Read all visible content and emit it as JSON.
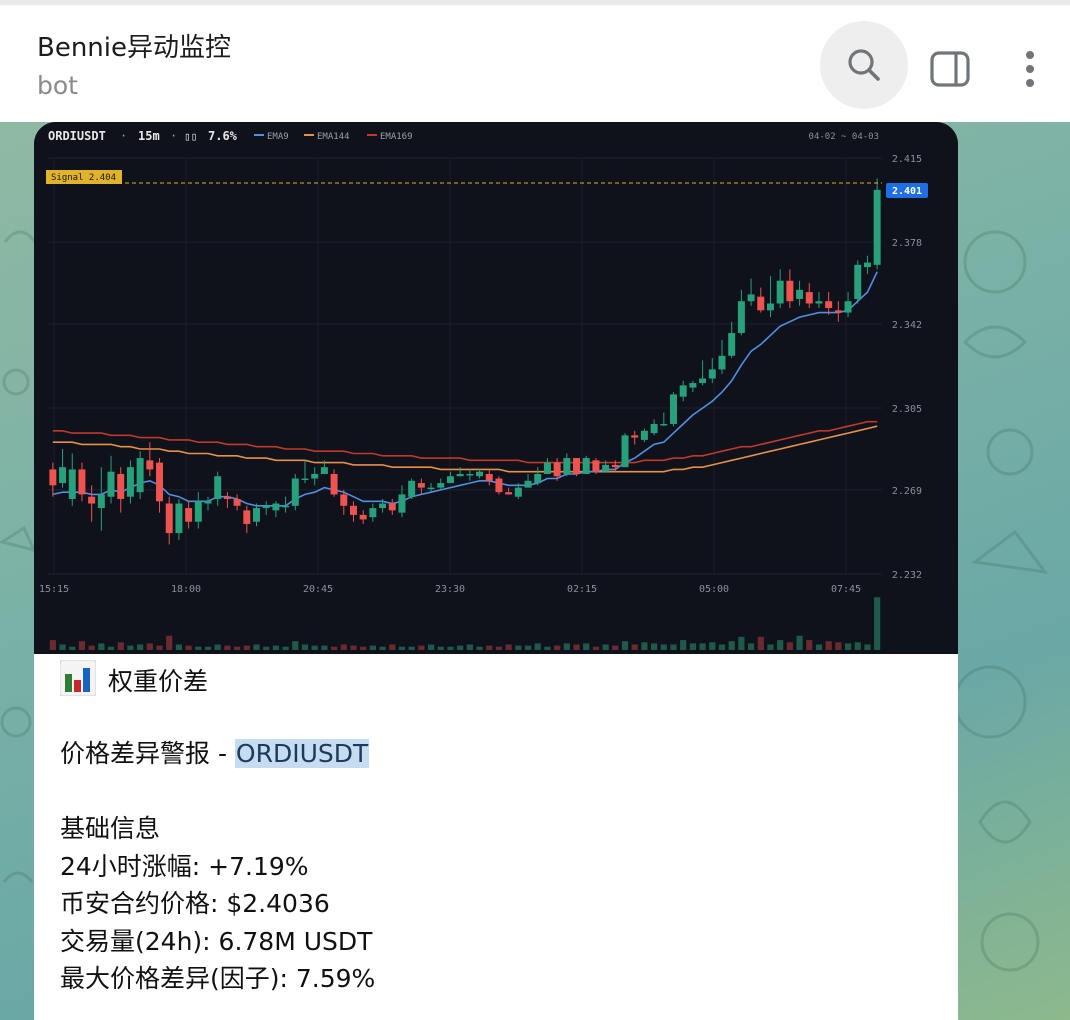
{
  "header": {
    "title": "Bennie异动监控",
    "subtitle": "bot",
    "icons": [
      "search-icon",
      "side-panel-icon",
      "more-vertical-icon"
    ]
  },
  "colors": {
    "bull": "#26a17b",
    "bear": "#ef5350",
    "ema9": "#4f8fe6",
    "ema144": "#e8904a",
    "ema169": "#c0392b",
    "signal": "#e0b32a",
    "chart_bg": "#0f121a",
    "highlight": "#c6dcf0"
  },
  "chart_data": {
    "type": "candlestick",
    "header": {
      "symbol": "ORDIUSDT",
      "sep1": "·",
      "interval": "15m",
      "sep2": "·",
      "tag": "▯▯",
      "change": "7.6%",
      "date_range": "04-02 ~ 04-03"
    },
    "legend": [
      {
        "name": "EMA9",
        "color": "#4f8fe6"
      },
      {
        "name": "EMA144",
        "color": "#e8904a"
      },
      {
        "name": "EMA169",
        "color": "#c0392b"
      }
    ],
    "y_ticks": [
      "2.415",
      "2.378",
      "2.342",
      "2.305",
      "2.269",
      "2.232"
    ],
    "ylim": [
      2.232,
      2.415
    ],
    "x_ticks": [
      "15:15",
      "18:00",
      "20:45",
      "23:30",
      "02:15",
      "05:00",
      "07:45"
    ],
    "signal": {
      "label": "Signal 2.404",
      "value": 2.404
    },
    "last_price": {
      "label": "2.401",
      "value": 2.401
    },
    "candles": [
      [
        2.278,
        2.271,
        2.281,
        2.266
      ],
      [
        2.272,
        2.279,
        2.287,
        2.27
      ],
      [
        2.265,
        2.278,
        2.285,
        2.262
      ],
      [
        2.278,
        2.267,
        2.281,
        2.264
      ],
      [
        2.266,
        2.263,
        2.271,
        2.255
      ],
      [
        2.261,
        2.267,
        2.279,
        2.251
      ],
      [
        2.266,
        2.277,
        2.284,
        2.263
      ],
      [
        2.276,
        2.265,
        2.279,
        2.259
      ],
      [
        2.266,
        2.279,
        2.282,
        2.263
      ],
      [
        2.268,
        2.283,
        2.286,
        2.265
      ],
      [
        2.282,
        2.278,
        2.29,
        2.275
      ],
      [
        2.281,
        2.264,
        2.283,
        2.259
      ],
      [
        2.263,
        2.25,
        2.266,
        2.245
      ],
      [
        2.25,
        2.263,
        2.265,
        2.247
      ],
      [
        2.261,
        2.255,
        2.264,
        2.252
      ],
      [
        2.255,
        2.264,
        2.268,
        2.252
      ],
      [
        2.263,
        2.264,
        2.266,
        2.26
      ],
      [
        2.265,
        2.275,
        2.277,
        2.262
      ],
      [
        2.266,
        2.265,
        2.268,
        2.261
      ],
      [
        2.265,
        2.262,
        2.267,
        2.26
      ],
      [
        2.26,
        2.254,
        2.262,
        2.25
      ],
      [
        2.255,
        2.261,
        2.263,
        2.253
      ],
      [
        2.261,
        2.262,
        2.264,
        2.258
      ],
      [
        2.26,
        2.263,
        2.264,
        2.257
      ],
      [
        2.262,
        2.262,
        2.266,
        2.259
      ],
      [
        2.262,
        2.274,
        2.276,
        2.26
      ],
      [
        2.274,
        2.274,
        2.282,
        2.272
      ],
      [
        2.274,
        2.276,
        2.279,
        2.271
      ],
      [
        2.276,
        2.279,
        2.282,
        2.276
      ],
      [
        2.276,
        2.267,
        2.278,
        2.266
      ],
      [
        2.267,
        2.262,
        2.269,
        2.258
      ],
      [
        2.262,
        2.258,
        2.264,
        2.255
      ],
      [
        2.258,
        2.256,
        2.26,
        2.254
      ],
      [
        2.257,
        2.261,
        2.263,
        2.255
      ],
      [
        2.261,
        2.263,
        2.265,
        2.259
      ],
      [
        2.263,
        2.26,
        2.265,
        2.258
      ],
      [
        2.259,
        2.267,
        2.271,
        2.257
      ],
      [
        2.266,
        2.273,
        2.274,
        2.265
      ],
      [
        2.272,
        2.27,
        2.274,
        2.267
      ],
      [
        2.27,
        2.27,
        2.272,
        2.268
      ],
      [
        2.27,
        2.272,
        2.274,
        2.269
      ],
      [
        2.272,
        2.275,
        2.277,
        2.272
      ],
      [
        2.275,
        2.276,
        2.279,
        2.275
      ],
      [
        2.276,
        2.276,
        2.278,
        2.273
      ],
      [
        2.275,
        2.277,
        2.278,
        2.274
      ],
      [
        2.276,
        2.273,
        2.278,
        2.271
      ],
      [
        2.274,
        2.268,
        2.275,
        2.267
      ],
      [
        2.268,
        2.267,
        2.27,
        2.267
      ],
      [
        2.266,
        2.27,
        2.272,
        2.265
      ],
      [
        2.27,
        2.273,
        2.276,
        2.27
      ],
      [
        2.272,
        2.276,
        2.279,
        2.271
      ],
      [
        2.276,
        2.281,
        2.283,
        2.276
      ],
      [
        2.281,
        2.275,
        2.283,
        2.273
      ],
      [
        2.276,
        2.283,
        2.285,
        2.275
      ],
      [
        2.283,
        2.276,
        2.283,
        2.275
      ],
      [
        2.276,
        2.283,
        2.284,
        2.276
      ],
      [
        2.282,
        2.277,
        2.283,
        2.276
      ],
      [
        2.277,
        2.28,
        2.282,
        2.277
      ],
      [
        2.28,
        2.279,
        2.282,
        2.277
      ],
      [
        2.279,
        2.293,
        2.294,
        2.28
      ],
      [
        2.293,
        2.292,
        2.295,
        2.289
      ],
      [
        2.291,
        2.295,
        2.296,
        2.29
      ],
      [
        2.294,
        2.298,
        2.3,
        2.293
      ],
      [
        2.298,
        2.298,
        2.303,
        2.297
      ],
      [
        2.298,
        2.311,
        2.312,
        2.297
      ],
      [
        2.31,
        2.315,
        2.317,
        2.308
      ],
      [
        2.314,
        2.316,
        2.317,
        2.312
      ],
      [
        2.316,
        2.318,
        2.326,
        2.315
      ],
      [
        2.318,
        2.322,
        2.327,
        2.316
      ],
      [
        2.322,
        2.328,
        2.335,
        2.32
      ],
      [
        2.328,
        2.338,
        2.343,
        2.327
      ],
      [
        2.338,
        2.352,
        2.357,
        2.337
      ],
      [
        2.352,
        2.355,
        2.362,
        2.35
      ],
      [
        2.354,
        2.348,
        2.358,
        2.347
      ],
      [
        2.348,
        2.351,
        2.363,
        2.345
      ],
      [
        2.351,
        2.361,
        2.366,
        2.349
      ],
      [
        2.361,
        2.352,
        2.366,
        2.349
      ],
      [
        2.353,
        2.357,
        2.361,
        2.35
      ],
      [
        2.356,
        2.351,
        2.36,
        2.349
      ],
      [
        2.351,
        2.352,
        2.356,
        2.349
      ],
      [
        2.352,
        2.349,
        2.356,
        2.346
      ],
      [
        2.348,
        2.347,
        2.352,
        2.343
      ],
      [
        2.347,
        2.352,
        2.356,
        2.345
      ],
      [
        2.353,
        2.368,
        2.37,
        2.351
      ],
      [
        2.367,
        2.369,
        2.372,
        2.364
      ],
      [
        2.368,
        2.401,
        2.406,
        2.366
      ]
    ],
    "volumes": [
      0.09,
      0.05,
      0.03,
      0.08,
      0.04,
      0.06,
      0.03,
      0.07,
      0.04,
      0.05,
      0.06,
      0.04,
      0.13,
      0.05,
      0.04,
      0.03,
      0.03,
      0.05,
      0.04,
      0.03,
      0.04,
      0.05,
      0.03,
      0.04,
      0.03,
      0.08,
      0.05,
      0.04,
      0.04,
      0.03,
      0.05,
      0.04,
      0.03,
      0.04,
      0.03,
      0.05,
      0.03,
      0.03,
      0.04,
      0.05,
      0.03,
      0.03,
      0.04,
      0.05,
      0.03,
      0.04,
      0.03,
      0.05,
      0.04,
      0.04,
      0.06,
      0.03,
      0.04,
      0.06,
      0.05,
      0.06,
      0.03,
      0.05,
      0.04,
      0.08,
      0.05,
      0.07,
      0.06,
      0.05,
      0.05,
      0.09,
      0.06,
      0.06,
      0.07,
      0.05,
      0.08,
      0.12,
      0.06,
      0.12,
      0.05,
      0.09,
      0.07,
      0.13,
      0.09,
      0.05,
      0.08,
      0.07,
      0.06,
      0.07,
      0.05,
      0.48
    ],
    "ema9": [
      2.267,
      2.268,
      2.268,
      2.268,
      2.267,
      2.267,
      2.269,
      2.268,
      2.27,
      2.272,
      2.273,
      2.271,
      2.267,
      2.266,
      2.264,
      2.264,
      2.264,
      2.266,
      2.266,
      2.265,
      2.263,
      2.262,
      2.262,
      2.262,
      2.262,
      2.265,
      2.267,
      2.268,
      2.27,
      2.269,
      2.268,
      2.266,
      2.264,
      2.264,
      2.264,
      2.263,
      2.264,
      2.266,
      2.267,
      2.268,
      2.269,
      2.27,
      2.271,
      2.272,
      2.273,
      2.273,
      2.272,
      2.271,
      2.271,
      2.271,
      2.272,
      2.274,
      2.274,
      2.276,
      2.276,
      2.277,
      2.277,
      2.278,
      2.278,
      2.281,
      2.283,
      2.286,
      2.289,
      2.29,
      2.294,
      2.298,
      2.302,
      2.305,
      2.308,
      2.312,
      2.317,
      2.324,
      2.33,
      2.333,
      2.337,
      2.341,
      2.343,
      2.345,
      2.346,
      2.347,
      2.347,
      2.347,
      2.348,
      2.352,
      2.356,
      2.365
    ],
    "ema144": [
      2.29,
      2.29,
      2.29,
      2.289,
      2.289,
      2.289,
      2.289,
      2.288,
      2.288,
      2.287,
      2.287,
      2.287,
      2.286,
      2.286,
      2.285,
      2.285,
      2.285,
      2.284,
      2.284,
      2.284,
      2.283,
      2.283,
      2.283,
      2.282,
      2.282,
      2.282,
      2.282,
      2.281,
      2.281,
      2.281,
      2.281,
      2.28,
      2.28,
      2.28,
      2.28,
      2.279,
      2.279,
      2.279,
      2.279,
      2.279,
      2.278,
      2.278,
      2.278,
      2.278,
      2.278,
      2.278,
      2.278,
      2.277,
      2.277,
      2.277,
      2.277,
      2.277,
      2.277,
      2.277,
      2.277,
      2.277,
      2.277,
      2.277,
      2.277,
      2.277,
      2.277,
      2.277,
      2.277,
      2.277,
      2.278,
      2.278,
      2.279,
      2.279,
      2.28,
      2.281,
      2.282,
      2.283,
      2.284,
      2.285,
      2.286,
      2.287,
      2.288,
      2.289,
      2.29,
      2.291,
      2.292,
      2.293,
      2.294,
      2.295,
      2.296,
      2.297
    ],
    "ema169": [
      2.295,
      2.295,
      2.294,
      2.294,
      2.294,
      2.294,
      2.293,
      2.293,
      2.293,
      2.292,
      2.292,
      2.292,
      2.291,
      2.291,
      2.291,
      2.29,
      2.29,
      2.29,
      2.289,
      2.289,
      2.289,
      2.288,
      2.288,
      2.288,
      2.287,
      2.287,
      2.287,
      2.286,
      2.286,
      2.286,
      2.286,
      2.285,
      2.285,
      2.285,
      2.284,
      2.284,
      2.284,
      2.284,
      2.283,
      2.283,
      2.283,
      2.283,
      2.283,
      2.282,
      2.282,
      2.282,
      2.282,
      2.282,
      2.282,
      2.281,
      2.281,
      2.281,
      2.281,
      2.281,
      2.281,
      2.281,
      2.281,
      2.281,
      2.281,
      2.281,
      2.281,
      2.282,
      2.282,
      2.282,
      2.283,
      2.283,
      2.284,
      2.284,
      2.285,
      2.286,
      2.287,
      2.288,
      2.288,
      2.289,
      2.29,
      2.291,
      2.292,
      2.293,
      2.294,
      2.295,
      2.295,
      2.296,
      2.297,
      2.298,
      2.299,
      2.299
    ]
  },
  "message": {
    "heading": "权重价差",
    "alert_prefix": "价格差异警报 - ",
    "alert_symbol": "ORDIUSDT",
    "section_title": "基础信息",
    "lines": [
      "24小时涨幅: +7.19%",
      "币安合约价格: $2.4036",
      "交易量(24h): 6.78M USDT",
      "最大价格差异(因子): 7.59%"
    ]
  }
}
